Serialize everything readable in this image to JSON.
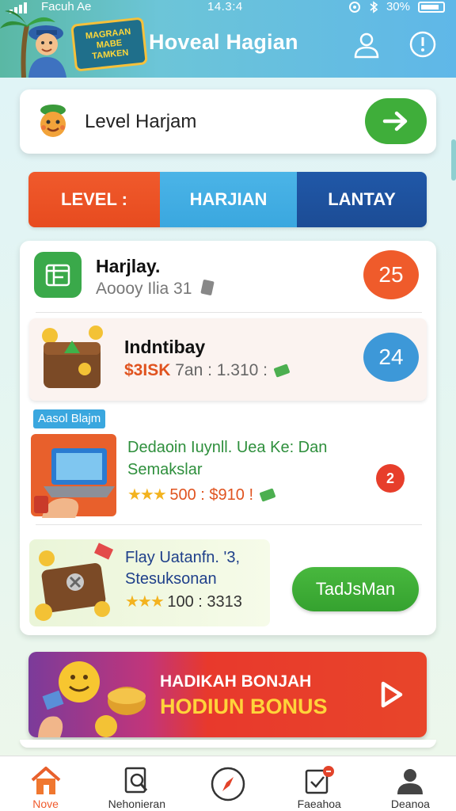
{
  "status_bar": {
    "carrier": "Facuh Ae",
    "time": "14.3:4",
    "battery": "30%"
  },
  "header": {
    "title": "Hoveal Hagian",
    "logo_lines": [
      "MAGRAAN",
      "MABE",
      "TAMKEN"
    ],
    "icons": [
      "user-icon",
      "info-icon"
    ]
  },
  "level_card": {
    "label": "Level Harjam"
  },
  "tabs": [
    "LEVEL :",
    "HARJIAN",
    "LANTAY"
  ],
  "list": {
    "row1": {
      "title": "Harjlay.",
      "subtitle": "Aoooy Ilia 31",
      "badge": "25"
    },
    "row2": {
      "title": "Indntibay",
      "price": "$3ISK",
      "detail": "7an : 1.310 :",
      "badge": "24"
    },
    "promo_tag": "Aasol Blajm",
    "row3": {
      "title": "Dedaoin Iuynll. Uea Ke: Dan",
      "subtitle": "Semakslar",
      "detail": "500 : $910 !",
      "alert": "2"
    },
    "row4": {
      "title": "Flay Uatanfn. '3,",
      "subtitle": "Stesuksonan",
      "detail": "100 : 3313",
      "button": "TadJsMan"
    }
  },
  "banner": {
    "line1": "HADIKAH BONJAH",
    "line2": "HODIUN BONUS"
  },
  "bottom_nav": [
    {
      "label": "Nove",
      "icon": "home-icon",
      "active": true
    },
    {
      "label": "Nehonieran",
      "icon": "search-document-icon",
      "active": false
    },
    {
      "label": "",
      "icon": "compass-icon",
      "active": false
    },
    {
      "label": "Faeahoa",
      "icon": "task-icon",
      "active": false
    },
    {
      "label": "Deanoa",
      "icon": "profile-icon",
      "active": false
    }
  ],
  "colors": {
    "accent_orange": "#f05a2c",
    "accent_blue": "#3aa7df",
    "accent_navy": "#1c4c95",
    "accent_green": "#3fae3a"
  }
}
